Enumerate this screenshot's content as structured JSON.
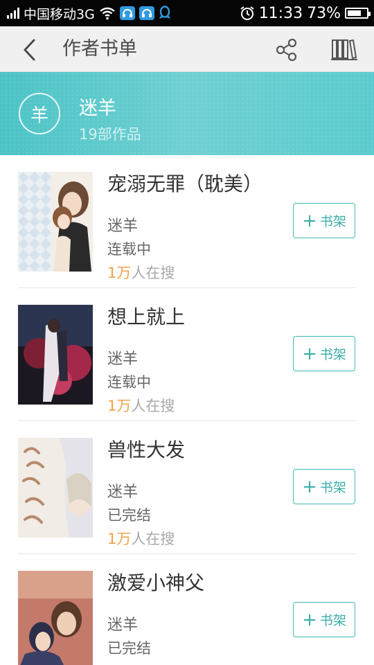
{
  "status_bar": {
    "carrier": "中国移动3G",
    "time": "11:33",
    "battery": "73%",
    "battery_level": 0.73,
    "icons": [
      "signal-icon",
      "wifi-icon",
      "app-notify-icon",
      "app-notify-icon",
      "qq-icon",
      "alarm-icon",
      "battery-icon"
    ]
  },
  "app_bar": {
    "title": "作者书单",
    "icons": [
      "back-arrow-icon",
      "share-icon",
      "bookshelf-icon"
    ]
  },
  "author": {
    "avatar_char": "羊",
    "name": "迷羊",
    "works": "19部作品"
  },
  "books": [
    {
      "title": "宠溺无罪（耽美）",
      "author": "迷羊",
      "status": "连载中",
      "search_num": "1万",
      "search_suffix": "人在搜",
      "button": "书架"
    },
    {
      "title": "想上就上",
      "author": "迷羊",
      "status": "连载中",
      "search_num": "1万",
      "search_suffix": "人在搜",
      "button": "书架"
    },
    {
      "title": "兽性大发",
      "author": "迷羊",
      "status": "已完结",
      "search_num": "1万",
      "search_suffix": "人在搜",
      "button": "书架"
    },
    {
      "title": "激爱小神父",
      "author": "迷羊",
      "status": "已完结",
      "search_num": "",
      "search_suffix": "",
      "button": "书架"
    }
  ],
  "colors": {
    "accent": "#3db8b5",
    "banner": "#5ccbcd",
    "highlight": "#f0a247"
  }
}
